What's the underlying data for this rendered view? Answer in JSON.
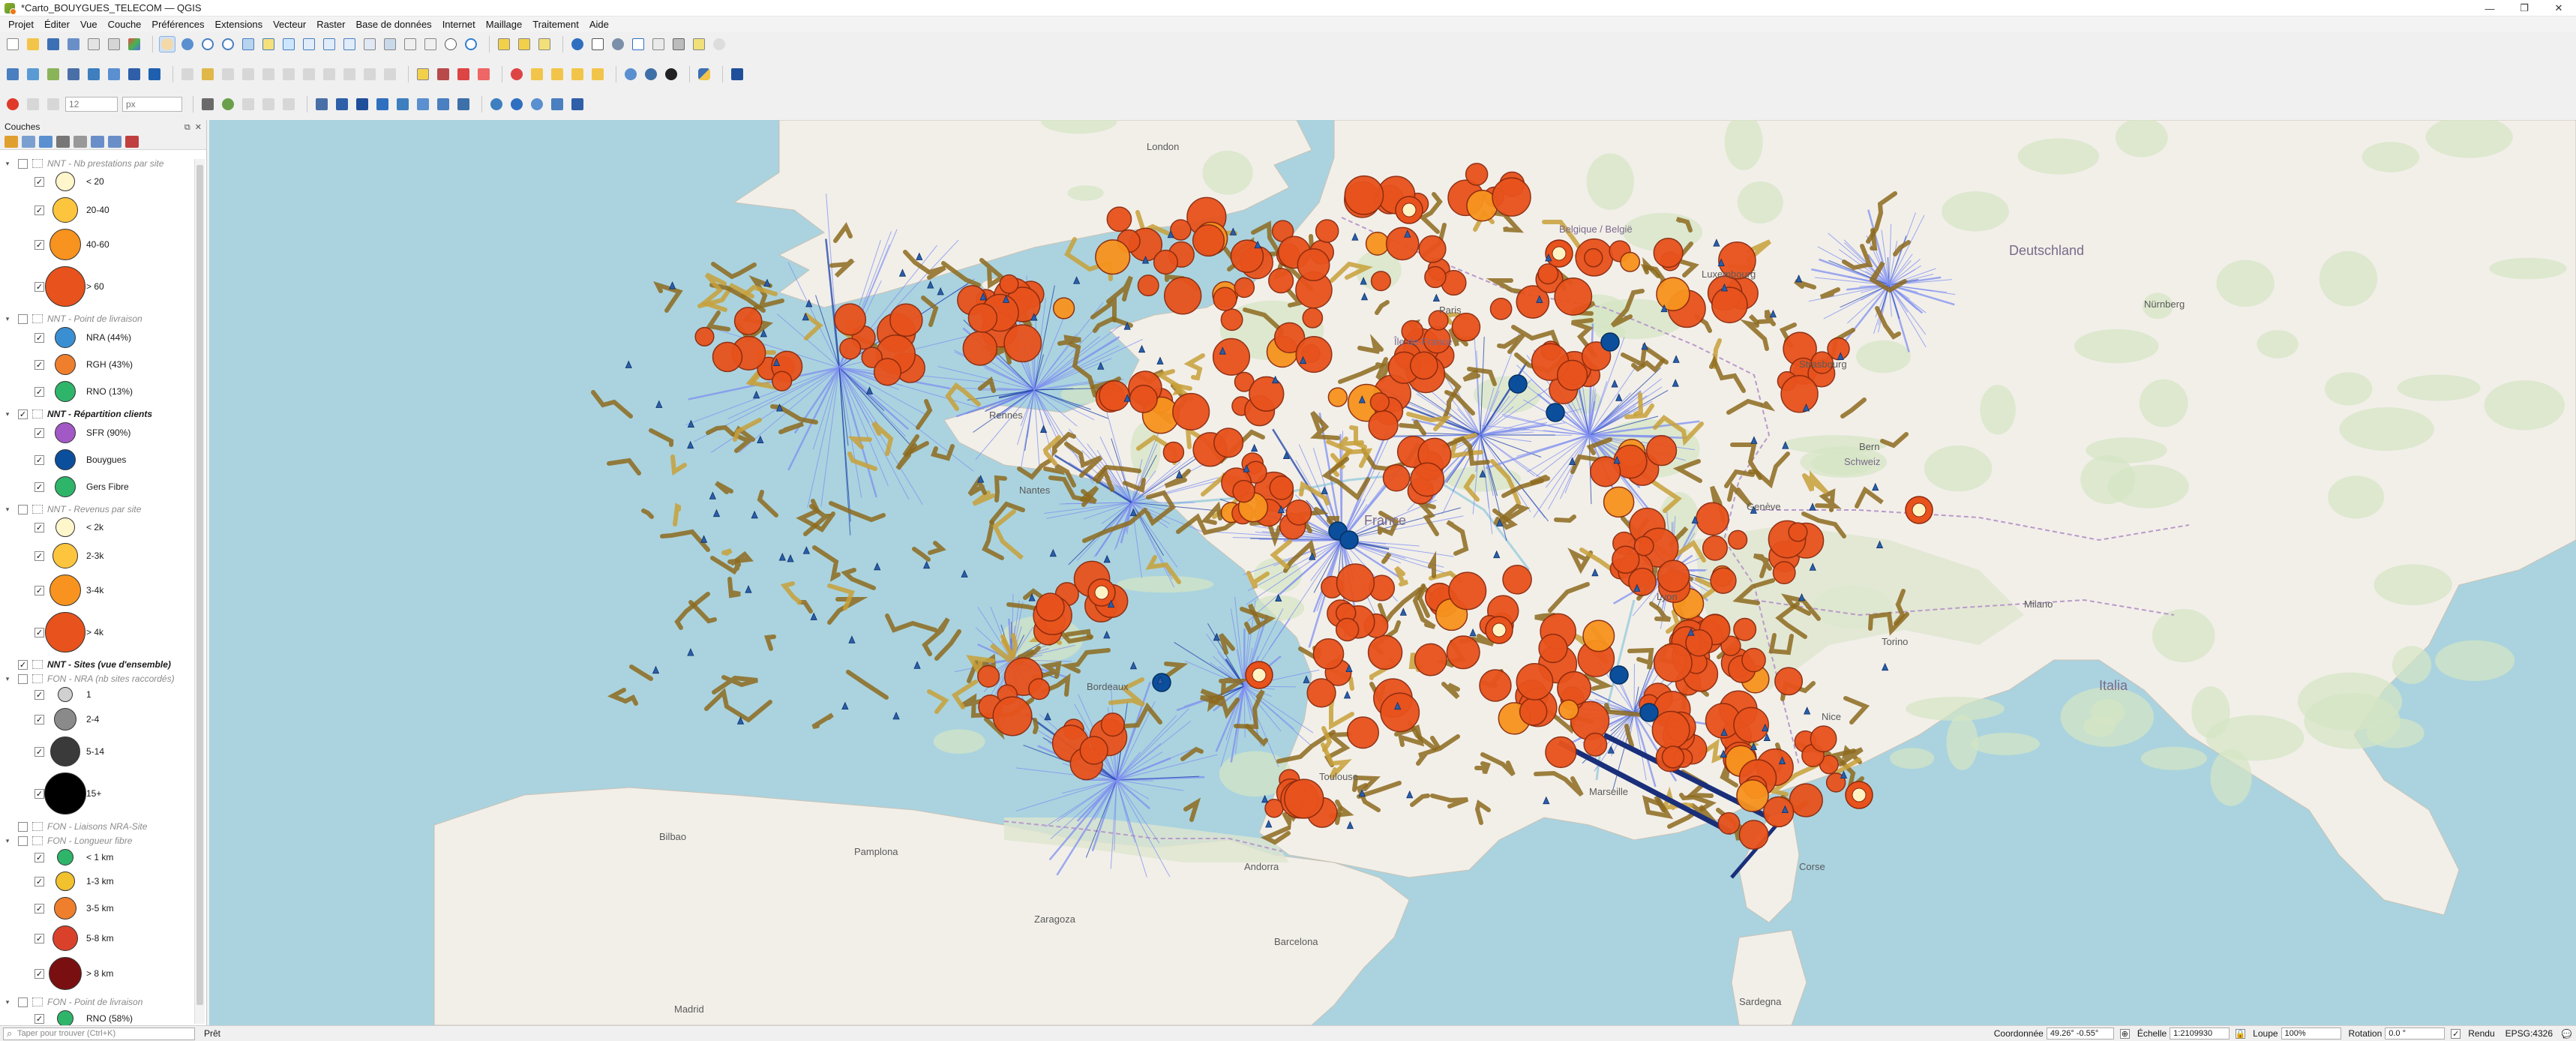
{
  "window": {
    "title": "*Carto_BOUYGUES_TELECOM — QGIS",
    "controls": [
      "—",
      "❐",
      "✕"
    ]
  },
  "menu": [
    "Projet",
    "Éditer",
    "Vue",
    "Couche",
    "Préférences",
    "Extensions",
    "Vecteur",
    "Raster",
    "Base de données",
    "Internet",
    "Maillage",
    "Traitement",
    "Aide"
  ],
  "toolbar3": {
    "size_value": "12",
    "unit_value": "px"
  },
  "layers_panel": {
    "title": "Couches",
    "groups": [
      {
        "label": "NNT - Nb prestations par site",
        "checked": false,
        "items": [
          {
            "label": "< 20",
            "color": "#fff6cc",
            "size": 26
          },
          {
            "label": "20-40",
            "color": "#fdc53d",
            "size": 34
          },
          {
            "label": "40-60",
            "color": "#f7931e",
            "size": 42
          },
          {
            "label": "> 60",
            "color": "#e8521c",
            "size": 54
          }
        ]
      },
      {
        "label": "NNT - Point de livraison",
        "checked": false,
        "items": [
          {
            "label": "NRA (44%)",
            "color": "#3a8fd2",
            "size": 28
          },
          {
            "label": "RGH (43%)",
            "color": "#ef7f2d",
            "size": 28
          },
          {
            "label": "RNO (13%)",
            "color": "#2eb56a",
            "size": 28
          }
        ]
      },
      {
        "label": "NNT - Répartition clients",
        "checked": true,
        "items": [
          {
            "label": "SFR (90%)",
            "color": "#a259c6",
            "size": 28
          },
          {
            "label": "Bouygues",
            "color": "#0b4f9c",
            "size": 28
          },
          {
            "label": "Gers Fibre",
            "color": "#2eb56a",
            "size": 28
          }
        ]
      },
      {
        "label": "NNT - Revenus par site",
        "checked": false,
        "items": [
          {
            "label": "< 2k",
            "color": "#fff6cc",
            "size": 26
          },
          {
            "label": "2-3k",
            "color": "#fdc53d",
            "size": 34
          },
          {
            "label": "3-4k",
            "color": "#f7931e",
            "size": 42
          },
          {
            "label": "> 4k",
            "color": "#e8521c",
            "size": 54
          }
        ]
      },
      {
        "label": "NNT - Sites (vue d'ensemble)",
        "checked": true,
        "items": []
      },
      {
        "label": "FON - NRA (nb sites raccordés)",
        "checked": false,
        "items": [
          {
            "label": "1",
            "color": "#d0d0d0",
            "size": 20
          },
          {
            "label": "2-4",
            "color": "#8a8a8a",
            "size": 30
          },
          {
            "label": "5-14",
            "color": "#3a3a3a",
            "size": 40
          },
          {
            "label": "15+",
            "color": "#000000",
            "size": 56
          }
        ]
      },
      {
        "label": "FON - Liaisons NRA-Site",
        "checked": false,
        "items": []
      },
      {
        "label": "FON - Longueur fibre",
        "checked": false,
        "items": [
          {
            "label": "< 1 km",
            "color": "#2eb56a",
            "size": 22
          },
          {
            "label": "1-3 km",
            "color": "#f2c12e",
            "size": 26
          },
          {
            "label": "3-5 km",
            "color": "#ef7f2d",
            "size": 30
          },
          {
            "label": "5-8 km",
            "color": "#d9412b",
            "size": 34
          },
          {
            "label": "> 8 km",
            "color": "#7a0f12",
            "size": 44
          }
        ]
      },
      {
        "label": "FON - Point de livraison",
        "checked": false,
        "items": [
          {
            "label": "RNO (58%)",
            "color": "#2eb56a",
            "size": 22
          }
        ]
      }
    ]
  },
  "map": {
    "labels": [
      "France",
      "Paris",
      "Bordeaux",
      "Toulouse",
      "Marseille",
      "Nantes",
      "Rennes",
      "Lyon",
      "Île-de-France",
      "Strasbourg",
      "Nice",
      "Zaragoza",
      "Barcelona",
      "Madrid",
      "Milano",
      "Torino",
      "Bern",
      "Genève",
      "Belgique / België",
      "Deutschland",
      "Schweiz",
      "Italia",
      "Corse",
      "London",
      "Luxembourg",
      "Nürnberg",
      "Bilbao",
      "Pamplona",
      "Andorra",
      "Sardegna"
    ]
  },
  "status": {
    "search_placeholder": "Taper pour trouver (Ctrl+K)",
    "message": "Prêt",
    "coord_label": "Coordonnée",
    "coord_value": "49.26° -0.55°",
    "scale_label": "Échelle",
    "scale_value": "1:2109930",
    "magnifier_label": "Loupe",
    "magnifier_value": "100%",
    "rotation_label": "Rotation",
    "rotation_value": "0.0 °",
    "render_label": "Rendu",
    "crs": "EPSG:4326"
  },
  "colors": {
    "accent": "#e8521c",
    "route": "#8d6a1f",
    "link": "#6e7fe8",
    "bouygues": "#0b4f9c"
  }
}
